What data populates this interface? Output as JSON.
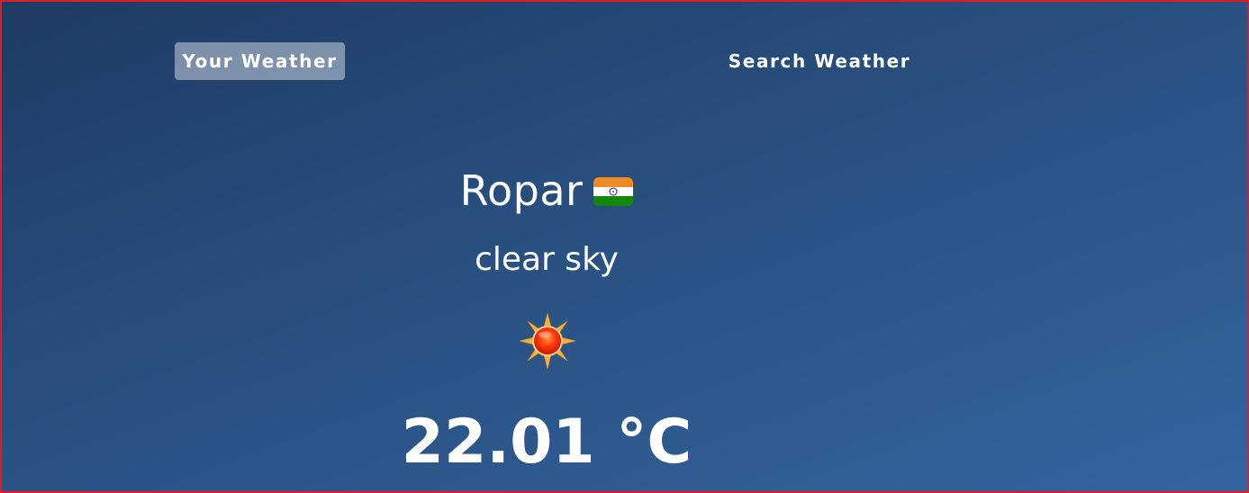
{
  "nav": {
    "your_weather_label": "Your Weather",
    "search_weather_label": "Search Weather",
    "active_tab": "Your Weather"
  },
  "weather": {
    "city": "Ropar",
    "country_flag_icon": "india-flag-icon",
    "description": "clear sky",
    "condition_icon": "sun-icon",
    "temperature": "22.01 °C"
  },
  "colors": {
    "background_top": "#1e3b64",
    "background_bottom": "#3564a0",
    "active_tab_bg": "rgba(255,255,255,0.42)",
    "frame_border": "#e11b22",
    "text": "#ffffff"
  }
}
